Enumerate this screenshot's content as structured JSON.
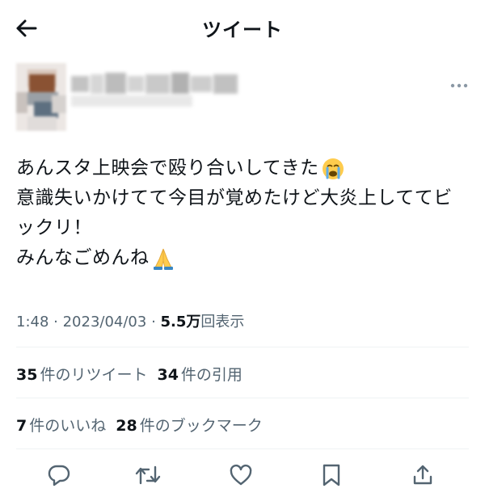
{
  "header": {
    "title": "ツイート",
    "back_icon": "arrow-left-icon"
  },
  "author": {
    "avatar": "blurred-avatar",
    "name": "",
    "more_icon": "more-horizontal-icon"
  },
  "tweet": {
    "lines": [
      "あんスタ上映会で殴り合いしてきた",
      "意識失いかけてて今目が覚めたけど大炎上しててビ",
      "ックリ！",
      "みんなごめんね"
    ],
    "emoji_line1": "crying-face",
    "emoji_line4": "folded-hands"
  },
  "meta": {
    "time": "1:48",
    "sep1": " · ",
    "date": "2023/04/03",
    "sep2": " · ",
    "views_count": "5.5万",
    "views_label": "回表示"
  },
  "stats": {
    "retweets_count": "35",
    "retweets_label": "件のリツイート",
    "quotes_count": "34",
    "quotes_label": "件の引用",
    "likes_count": "7",
    "likes_label": "件のいいね",
    "bookmarks_count": "28",
    "bookmarks_label": "件のブックマーク"
  },
  "actions": [
    "reply-icon",
    "retweet-icon",
    "like-icon",
    "bookmark-icon",
    "share-icon"
  ],
  "colors": {
    "text": "#0f1419",
    "secondary": "#536471",
    "divider": "#eff3f4"
  }
}
